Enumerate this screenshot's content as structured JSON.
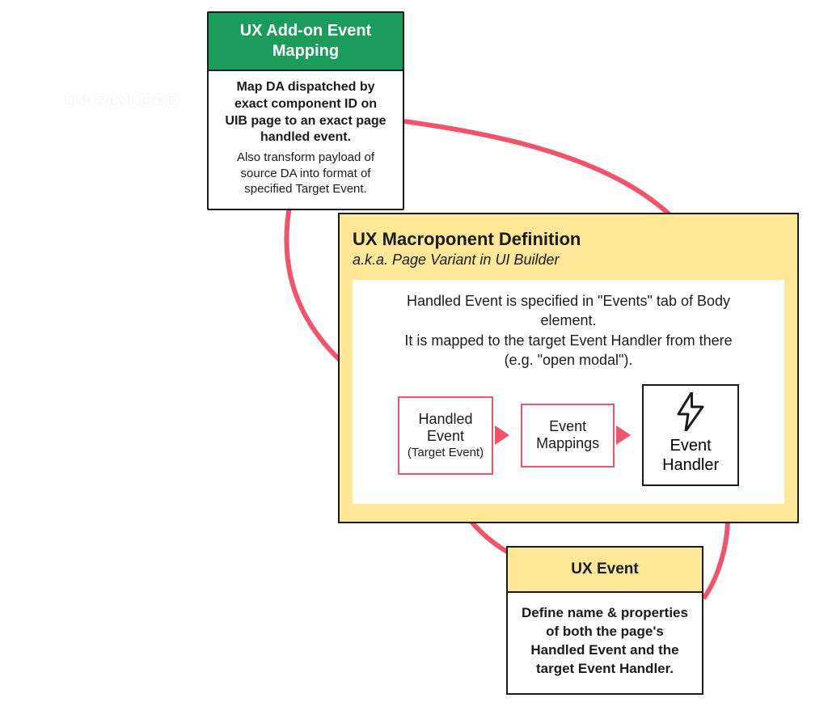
{
  "da_payload": "DA PAYLOAD",
  "addon": {
    "header": "UX Add-on Event Mapping",
    "body_strong": "Map DA dispatched by exact component ID on UIB page to an exact page handled event.",
    "body_sub": "Also transform payload of source DA into format of specified Target Event."
  },
  "macro": {
    "title": "UX Macroponent Definition",
    "subtitle": "a.k.a. Page Variant in UI Builder",
    "desc": "Handled Event is specified in \"Events\" tab of Body element.\nIt is mapped to the target Event Handler from there (e.g. \"open modal\").",
    "handled_event_line1": "Handled",
    "handled_event_line2": "Event",
    "handled_event_sub": "(Target Event)",
    "mappings_line1": "Event",
    "mappings_line2": "Mappings",
    "handler_line1": "Event",
    "handler_line2": "Handler"
  },
  "ux_event": {
    "header": "UX Event",
    "body": "Define name & properties of both the page's Handled Event and the target Event Handler."
  }
}
